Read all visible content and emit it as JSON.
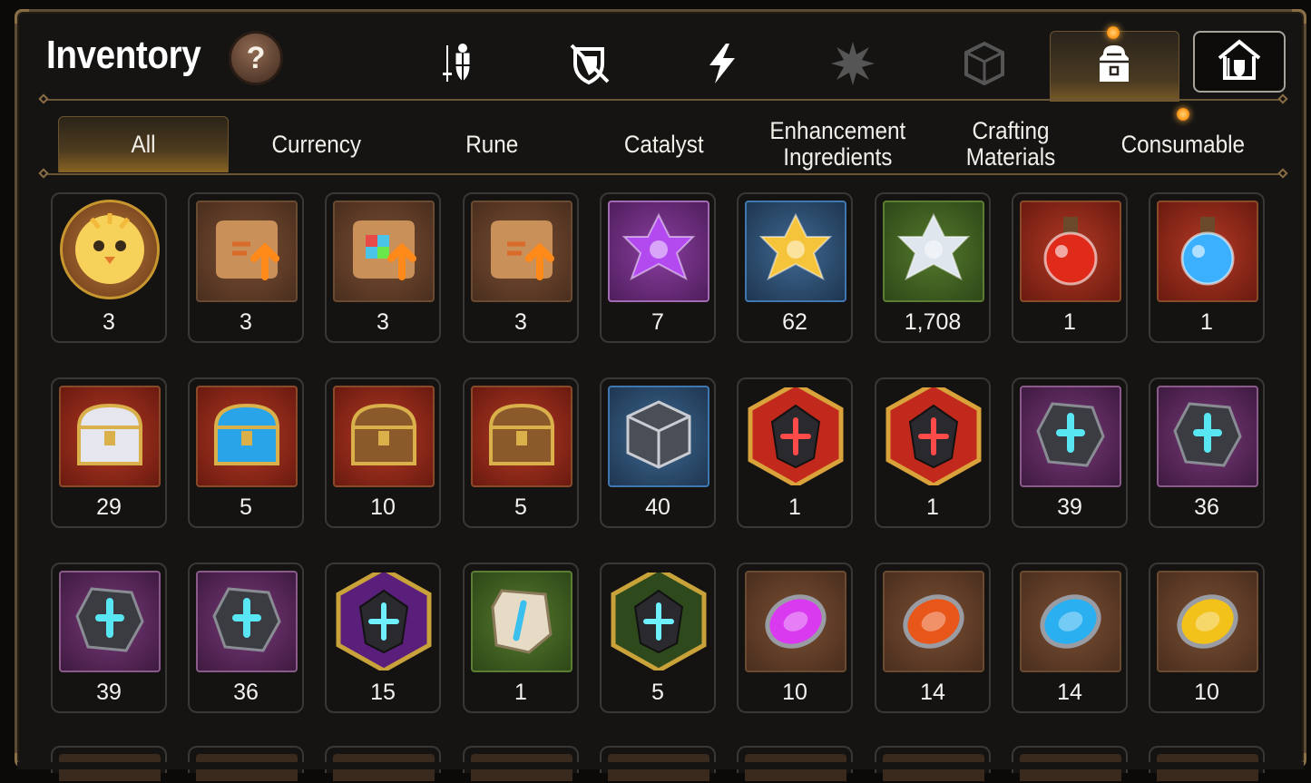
{
  "header": {
    "title": "Inventory",
    "help_label": "?"
  },
  "category_icons": [
    {
      "name": "equipment",
      "icon": "sword-shield-icon",
      "active": false
    },
    {
      "name": "disabled-equipment",
      "icon": "crossed-shield-icon",
      "active": false
    },
    {
      "name": "skill",
      "icon": "lightning-icon",
      "active": false
    },
    {
      "name": "artifact",
      "icon": "burst-icon",
      "active": false
    },
    {
      "name": "dice",
      "icon": "dice-icon",
      "active": false
    },
    {
      "name": "bag",
      "icon": "backpack-icon",
      "active": true
    },
    {
      "name": "guild",
      "icon": "guild-house-icon",
      "active": false
    }
  ],
  "tabs": [
    {
      "label": "All",
      "active": true
    },
    {
      "label": "Currency",
      "active": false
    },
    {
      "label": "Rune",
      "active": false
    },
    {
      "label": "Catalyst",
      "active": false
    },
    {
      "label": "Enhancement Ingredients",
      "active": false
    },
    {
      "label": "Crafting Materials",
      "active": false
    },
    {
      "label": "Consumable",
      "active": false
    }
  ],
  "items": [
    {
      "icon": "chick-avatar-coin-icon",
      "count": "3",
      "frame": "round"
    },
    {
      "icon": "scroll-upgrade-icon",
      "count": "3",
      "frame": "brown"
    },
    {
      "icon": "rainbow-scroll-upgrade-icon",
      "count": "3",
      "frame": "brown"
    },
    {
      "icon": "scroll-upgrade-icon",
      "count": "3",
      "frame": "brown"
    },
    {
      "icon": "purple-crystal-icon",
      "count": "7",
      "frame": "purple"
    },
    {
      "icon": "gold-crystal-icon",
      "count": "62",
      "frame": "blue"
    },
    {
      "icon": "silver-crystal-icon",
      "count": "1,708",
      "frame": "green"
    },
    {
      "icon": "red-potion-icon",
      "count": "1",
      "frame": "red"
    },
    {
      "icon": "star-potion-icon",
      "count": "1",
      "frame": "red"
    },
    {
      "icon": "silver-chest-icon",
      "count": "29",
      "frame": "red"
    },
    {
      "icon": "blue-chest-icon",
      "count": "5",
      "frame": "red"
    },
    {
      "icon": "gold-chest-icon",
      "count": "10",
      "frame": "red"
    },
    {
      "icon": "gold-chest-icon",
      "count": "5",
      "frame": "red"
    },
    {
      "icon": "dark-cube-icon",
      "count": "40",
      "frame": "blue"
    },
    {
      "icon": "red-rune-hex-icon",
      "count": "1",
      "frame": "hex-red"
    },
    {
      "icon": "pink-potion-hex-icon",
      "count": "1",
      "frame": "hex-red"
    },
    {
      "icon": "sword-rune-stone-icon",
      "count": "39",
      "frame": "violet"
    },
    {
      "icon": "swirl-rune-stone-icon",
      "count": "36",
      "frame": "violet"
    },
    {
      "icon": "armor-rune-stone-icon",
      "count": "39",
      "frame": "violet"
    },
    {
      "icon": "boot-rune-stone-icon",
      "count": "36",
      "frame": "violet"
    },
    {
      "icon": "star-rune-hex-icon",
      "count": "15",
      "frame": "hex-purple"
    },
    {
      "icon": "sword-tablet-icon",
      "count": "1",
      "frame": "green"
    },
    {
      "icon": "star-tablet-hex-icon",
      "count": "5",
      "frame": "hex-green"
    },
    {
      "icon": "purple-orb-icon",
      "count": "10",
      "frame": "brown"
    },
    {
      "icon": "fire-orb-icon",
      "count": "14",
      "frame": "brown"
    },
    {
      "icon": "ice-orb-icon",
      "count": "14",
      "frame": "brown"
    },
    {
      "icon": "thunder-orb-icon",
      "count": "10",
      "frame": "brown"
    }
  ],
  "colors": {
    "accent_gold": "#8a6423",
    "frame_border": "#5b4a34",
    "notification": "#ff9a1a"
  }
}
